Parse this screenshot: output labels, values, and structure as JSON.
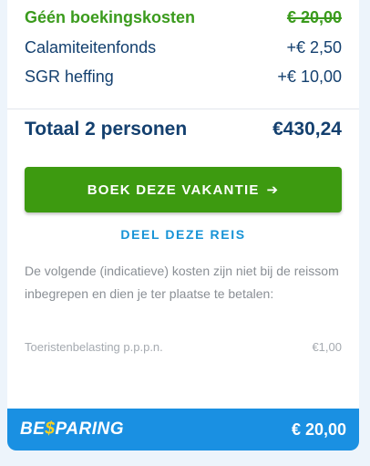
{
  "costs": {
    "booking_fee": {
      "label": "Géén boekingskosten",
      "amount": "€ 20,00"
    },
    "calamity_fund": {
      "label": "Calamiteitenfonds",
      "amount": "+€ 2,50"
    },
    "sgr_levy": {
      "label": "SGR heffing",
      "amount": "+€ 10,00"
    }
  },
  "total": {
    "label": "Totaal 2 personen",
    "amount": "€430,24"
  },
  "book_button": {
    "label": "BOEK DEZE VAKANTIE",
    "arrow": "➔"
  },
  "share_link": {
    "label": "DEEL DEZE REIS"
  },
  "excluded_note": "De volgende (indicatieve) kosten zijn niet bij de reissom inbegrepen en dien je ter plaatse te betalen:",
  "tourist_tax": {
    "label": "Toeristenbelasting p.p.p.n.",
    "amount": "€1,00"
  },
  "footer": {
    "logo_prefix": "BE",
    "logo_s": "$",
    "logo_suffix": "PARING",
    "amount": "€ 20,00"
  },
  "colors": {
    "page_background": "#edf4fb",
    "panel_background": "#ffffff",
    "green": "#3b9b1d",
    "navy": "#14406f",
    "link_blue": "#1793d6",
    "footer_blue": "#1a90e2",
    "logo_yellow": "#ffd21f"
  }
}
